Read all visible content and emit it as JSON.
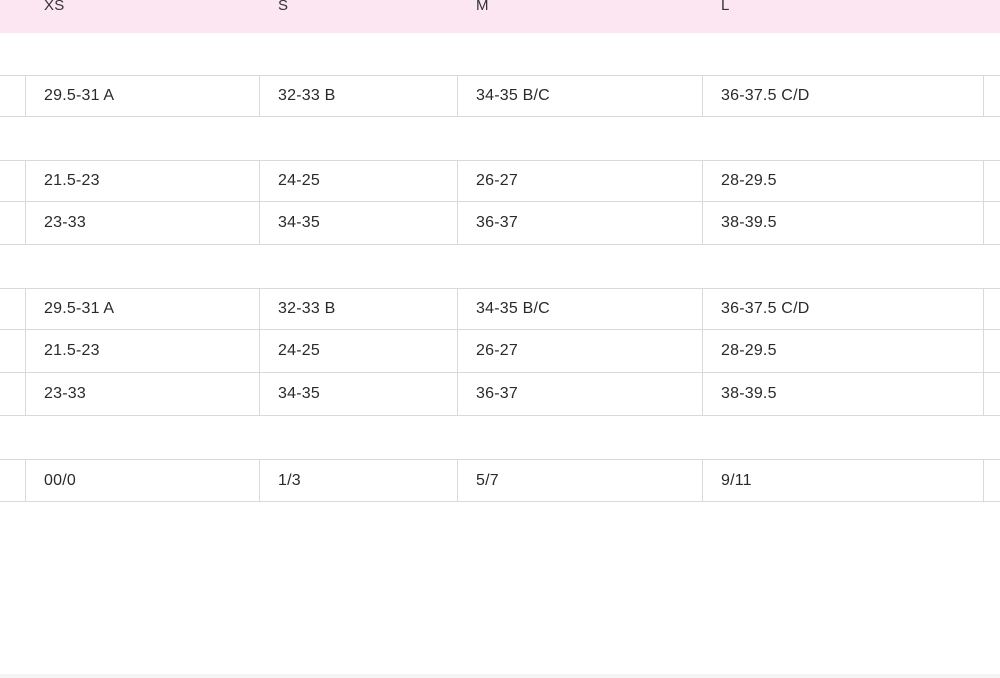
{
  "headers": [
    "XS",
    "S",
    "M",
    "L"
  ],
  "groups": [
    {
      "rows": [
        [
          "29.5-31 A",
          "32-33 B",
          "34-35 B/C",
          "36-37.5 C/D"
        ]
      ]
    },
    {
      "rows": [
        [
          "21.5-23",
          "24-25",
          "26-27",
          "28-29.5"
        ],
        [
          "23-33",
          "34-35",
          "36-37",
          "38-39.5"
        ]
      ]
    },
    {
      "rows": [
        [
          "29.5-31 A",
          "32-33 B",
          "34-35 B/C",
          "36-37.5 C/D"
        ],
        [
          "21.5-23",
          "24-25",
          "26-27",
          "28-29.5"
        ],
        [
          "23-33",
          "34-35",
          "36-37",
          "38-39.5"
        ]
      ]
    },
    {
      "rows": [
        [
          "00/0",
          "1/3",
          "5/7",
          "9/11"
        ]
      ]
    }
  ],
  "colors": {
    "header_bg": "#fbe6f2",
    "border": "#d9d9d9",
    "text": "#2a2a2a"
  }
}
